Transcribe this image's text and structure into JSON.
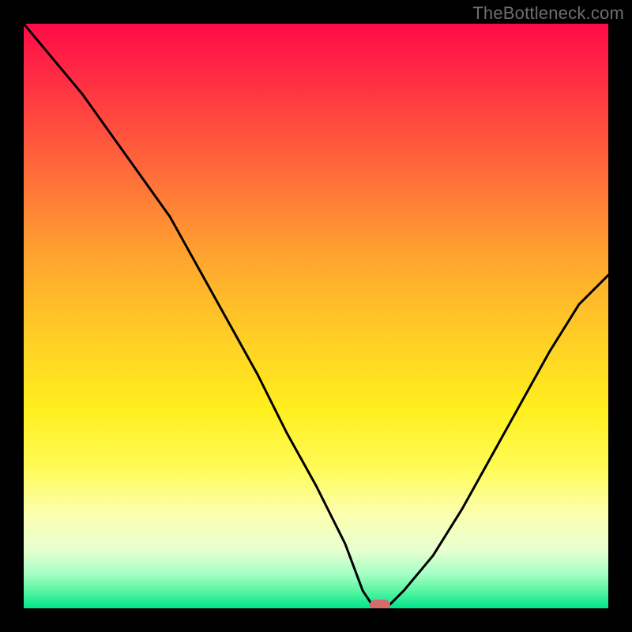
{
  "watermark": "TheBottleneck.com",
  "colors": {
    "frame": "#000000",
    "watermark": "#6d6d6d",
    "line": "#000000",
    "marker": "#d46a6a"
  },
  "chart_data": {
    "type": "line",
    "title": "",
    "xlabel": "",
    "ylabel": "",
    "xlim": [
      0,
      100
    ],
    "ylim": [
      0,
      100
    ],
    "grid": false,
    "legend": false,
    "series": [
      {
        "name": "curve",
        "x": [
          0,
          5,
          10,
          15,
          20,
          25,
          30,
          35,
          40,
          45,
          50,
          55,
          58,
          60,
          62,
          65,
          70,
          75,
          80,
          85,
          90,
          95,
          100
        ],
        "y": [
          100,
          94,
          88,
          81,
          74,
          67,
          58,
          49,
          40,
          30,
          21,
          11,
          3,
          0,
          0,
          3,
          9,
          17,
          26,
          35,
          44,
          52,
          57
        ]
      }
    ],
    "marker": {
      "x": 61,
      "y": 0
    },
    "background_gradient_meaning": "vertical color scale from red (top, high bottleneck) through orange/yellow to green (bottom, no bottleneck)"
  }
}
